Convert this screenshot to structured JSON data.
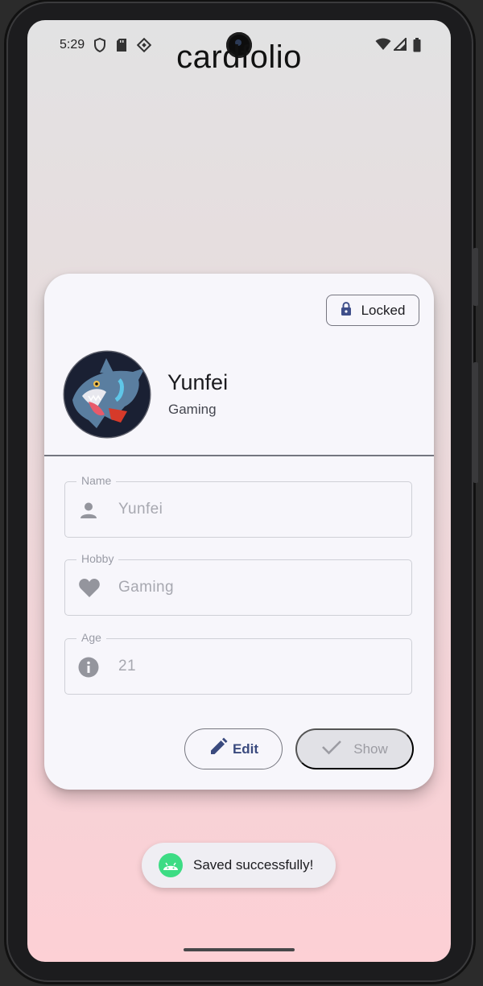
{
  "status_bar": {
    "time": "5:29",
    "left_icons": [
      "shield-icon",
      "sd-card-icon",
      "nfc-diamond-icon"
    ],
    "right_icons": [
      "wifi-icon",
      "signal-icon",
      "battery-icon"
    ]
  },
  "app": {
    "title": "cardfolio"
  },
  "card": {
    "lock_button": {
      "label": "Locked",
      "icon": "lock-icon"
    },
    "profile": {
      "name": "Yunfei",
      "hobby": "Gaming",
      "avatar": "shark-creature-avatar"
    },
    "fields": [
      {
        "label": "Name",
        "value": "Yunfei",
        "icon": "person-icon"
      },
      {
        "label": "Hobby",
        "value": "Gaming",
        "icon": "heart-icon"
      },
      {
        "label": "Age",
        "value": "21",
        "icon": "info-icon"
      }
    ],
    "edit_button": {
      "label": "Edit",
      "icon": "pencil-icon"
    },
    "show_button": {
      "label": "Show",
      "icon": "check-icon",
      "enabled": false
    }
  },
  "toast": {
    "message": "Saved successfully!",
    "icon": "android-icon"
  },
  "colors": {
    "accent": "#3a4a7e",
    "toast_icon_bg": "#3ddc84",
    "card_bg": "#f7f6fb",
    "background_top": "#e2e2e3",
    "background_bottom": "#fdd0d5"
  }
}
